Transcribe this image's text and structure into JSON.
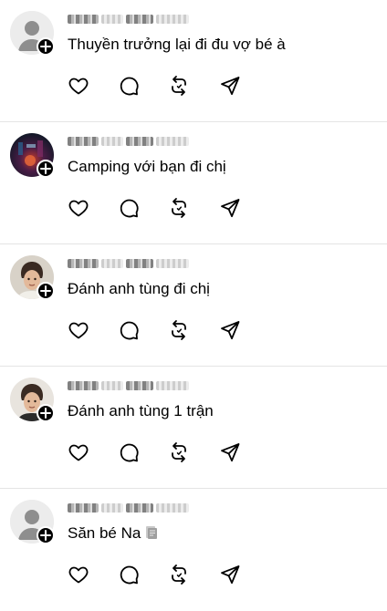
{
  "posts": [
    {
      "username": "",
      "text": "Thuyền trưởng lại đi đu vợ bé à",
      "avatar": "default-avatar-icon",
      "emoji": ""
    },
    {
      "username": "",
      "text": "Camping với bạn đi chị",
      "avatar": "night-scene-avatar",
      "emoji": ""
    },
    {
      "username": "",
      "text": "Đánh anh tùng đi chị",
      "avatar": "face-avatar",
      "emoji": ""
    },
    {
      "username": "",
      "text": "Đánh anh tùng 1 trận",
      "avatar": "face-avatar",
      "emoji": ""
    },
    {
      "username": "",
      "text": "Săn bé Na",
      "avatar": "default-avatar-icon",
      "emoji": "document-icon"
    }
  ],
  "icons": {
    "like": "heart-icon",
    "reply": "comment-icon",
    "repost": "repost-icon",
    "share": "send-icon",
    "follow": "plus-icon"
  },
  "colors": {
    "text": "#000000",
    "divider": "#e4e4e4",
    "icon": "#000000",
    "avatar_default": "#c8c8c8"
  }
}
